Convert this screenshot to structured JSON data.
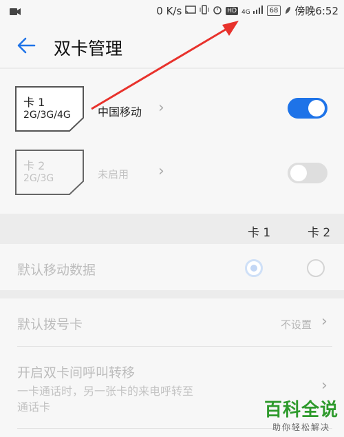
{
  "status_bar": {
    "net_speed": "0 K/s",
    "hd_badge": "HD",
    "signal_label": "4G",
    "battery": "68",
    "time": "傍晚6:52"
  },
  "header": {
    "title": "双卡管理"
  },
  "sim1": {
    "name": "卡 1",
    "networks": "2G/3G/4G",
    "carrier": "中国移动",
    "enabled": true
  },
  "sim2": {
    "name": "卡 2",
    "networks": "2G/3G",
    "carrier": "未启用",
    "enabled": false
  },
  "columns": {
    "card1": "卡 1",
    "card2": "卡 2"
  },
  "default_data": {
    "label": "默认移动数据",
    "selected": "card1"
  },
  "default_dial": {
    "label": "默认拨号卡",
    "value": "不设置"
  },
  "call_forward": {
    "title": "开启双卡间呼叫转移",
    "desc_line1": "一卡通话时，另一张卡的来电呼转至",
    "desc_line2": "通话卡"
  },
  "watermark": {
    "main": "百科全说",
    "sub": "助你轻松解决"
  },
  "colors": {
    "accent": "#1e73e8",
    "arrow": "#e8322c",
    "watermark": "#2e9a2c"
  }
}
